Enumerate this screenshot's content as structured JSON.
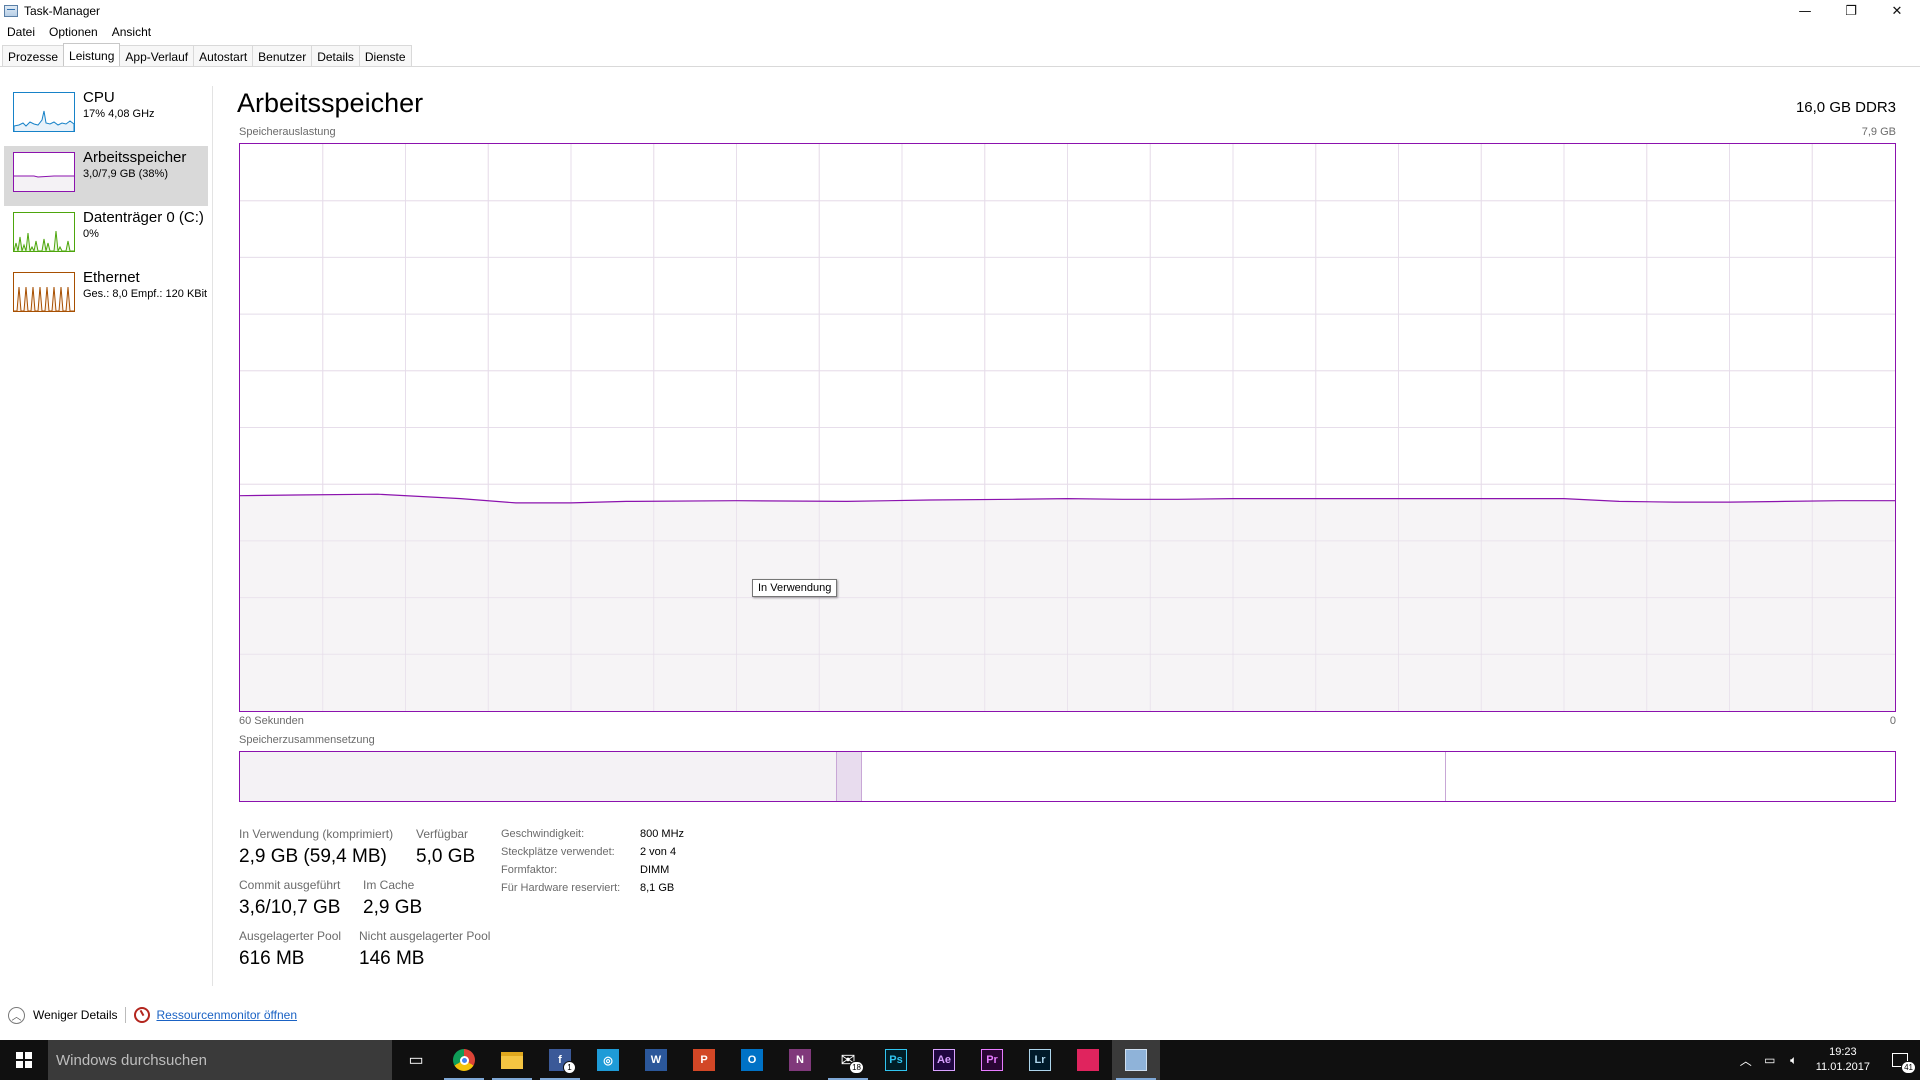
{
  "window": {
    "title": "Task-Manager",
    "minimize": "—",
    "restore": "❐",
    "close": "✕"
  },
  "menu": [
    "Datei",
    "Optionen",
    "Ansicht"
  ],
  "tabs": [
    "Prozesse",
    "Leistung",
    "App-Verlauf",
    "Autostart",
    "Benutzer",
    "Details",
    "Dienste"
  ],
  "active_tab": "Leistung",
  "sidebar": {
    "items": [
      {
        "title": "CPU",
        "sub": "17%  4,08 GHz",
        "color": "#1782c8"
      },
      {
        "title": "Arbeitsspeicher",
        "sub": "3,0/7,9 GB (38%)",
        "color": "#8b12ae"
      },
      {
        "title": "Datenträger 0 (C:)",
        "sub": "0%",
        "color": "#4da60c"
      },
      {
        "title": "Ethernet",
        "sub": "Ges.: 8,0  Empf.: 120 KBit",
        "color": "#a74f01"
      }
    ]
  },
  "main": {
    "title": "Arbeitsspeicher",
    "spec": "16,0 GB DDR3",
    "graph_label": "Speicherauslastung",
    "graph_max": "7,9 GB",
    "time_label": "60 Sekunden",
    "time_end": "0",
    "tooltip": "In Verwendung",
    "composition_label": "Speicherzusammensetzung"
  },
  "chart_data": {
    "type": "area",
    "ylim": [
      0,
      7.9
    ],
    "y_unit": "GB",
    "x": [
      60,
      58,
      55,
      52,
      50,
      48,
      46,
      42,
      38,
      35,
      32,
      30,
      28,
      26,
      24,
      22,
      20,
      18,
      16,
      14,
      12,
      10,
      8,
      6,
      4,
      2,
      0
    ],
    "values": [
      3.0,
      3.01,
      3.02,
      2.96,
      2.9,
      2.9,
      2.92,
      2.93,
      2.92,
      2.94,
      2.95,
      2.96,
      2.95,
      2.95,
      2.96,
      2.96,
      2.96,
      2.96,
      2.96,
      2.96,
      2.96,
      2.92,
      2.91,
      2.91,
      2.92,
      2.93,
      2.93
    ],
    "series_color": "#8b12ae",
    "fill_color": "#f4f2f5",
    "grid": true
  },
  "composition": {
    "in_use_fraction": 0.36,
    "modified_fraction": 0.016,
    "standby_fraction": 0.352,
    "free_fraction": 0.272
  },
  "stats": {
    "in_use_label": "In Verwendung (komprimiert)",
    "in_use_value": "2,9 GB (59,4 MB)",
    "available_label": "Verfügbar",
    "available_value": "5,0 GB",
    "commit_label": "Commit ausgeführt",
    "commit_value": "3,6/10,7 GB",
    "cache_label": "Im Cache",
    "cache_value": "2,9 GB",
    "paged_label": "Ausgelagerter Pool",
    "paged_value": "616 MB",
    "nonpaged_label": "Nicht ausgelagerter Pool",
    "nonpaged_value": "146 MB"
  },
  "details": [
    {
      "label": "Geschwindigkeit:",
      "value": "800 MHz"
    },
    {
      "label": "Steckplätze verwendet:",
      "value": "2 von 4"
    },
    {
      "label": "Formfaktor:",
      "value": "DIMM"
    },
    {
      "label": "Für Hardware reserviert:",
      "value": "8,1 GB"
    }
  ],
  "footer": {
    "fewer_details": "Weniger Details",
    "resource_monitor": "Ressourcenmonitor öffnen"
  },
  "taskbar": {
    "search_placeholder": "Windows durchsuchen",
    "apps": [
      {
        "name": "task-view",
        "label": "▭",
        "bg": "transparent"
      },
      {
        "name": "chrome",
        "label": "",
        "bg": "chrome"
      },
      {
        "name": "file-explorer",
        "label": "",
        "bg": "#f5c542"
      },
      {
        "name": "facebook",
        "label": "f",
        "bg": "#3b5998",
        "badge": "1"
      },
      {
        "name": "instagram",
        "label": "◎",
        "bg": "#1e9bd7"
      },
      {
        "name": "word",
        "label": "W",
        "bg": "#2b579a"
      },
      {
        "name": "powerpoint",
        "label": "P",
        "bg": "#d24726"
      },
      {
        "name": "outlook",
        "label": "O",
        "bg": "#0072c6"
      },
      {
        "name": "onenote",
        "label": "N",
        "bg": "#80397b"
      },
      {
        "name": "mail",
        "label": "✉",
        "bg": "transparent",
        "badge": "18"
      },
      {
        "name": "photoshop",
        "label": "Ps",
        "bg": "#001d26"
      },
      {
        "name": "after-effects",
        "label": "Ae",
        "bg": "#1f0740"
      },
      {
        "name": "premiere",
        "label": "Pr",
        "bg": "#2a0634"
      },
      {
        "name": "lightroom",
        "label": "Lr",
        "bg": "#001a2a"
      },
      {
        "name": "app-red",
        "label": "",
        "bg": "#e0245e"
      },
      {
        "name": "task-manager",
        "label": "",
        "bg": "#8fb3d9"
      }
    ],
    "time": "19:23",
    "date": "11.01.2017",
    "notification_count": "41"
  }
}
